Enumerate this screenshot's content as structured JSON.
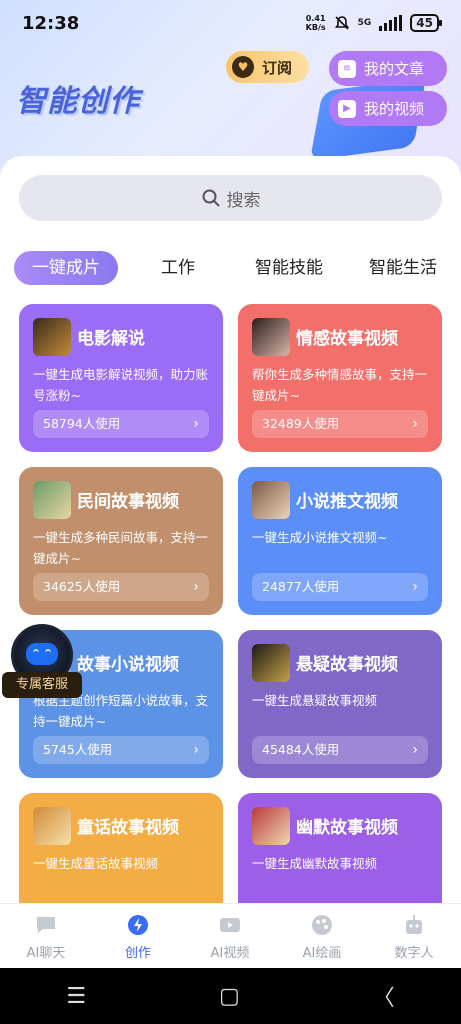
{
  "status_bar": {
    "time": "12:38",
    "net_speed_value": "0.41",
    "net_speed_unit": "KB/s",
    "network": "5G",
    "battery": "45"
  },
  "header": {
    "brand_title": "智能创作",
    "subscribe_label": "订阅",
    "my_articles_label": "我的文章",
    "my_videos_label": "我的视频"
  },
  "search": {
    "label": "搜索"
  },
  "tabs": [
    {
      "label": "一键成片",
      "active": true
    },
    {
      "label": "工作",
      "active": false
    },
    {
      "label": "智能技能",
      "active": false
    },
    {
      "label": "智能生活",
      "active": false
    }
  ],
  "cards": [
    {
      "title": "电影解说",
      "desc": "一键生成电影解说视频，助力账号涨粉~",
      "usage": "58794人使用",
      "color": "#9b6cf5"
    },
    {
      "title": "情感故事视频",
      "desc": "帮你生成多种情感故事，支持一键成片~",
      "usage": "32489人使用",
      "color": "#f36f6a"
    },
    {
      "title": "民间故事视频",
      "desc": "一键生成多种民间故事，支持一键成片~",
      "usage": "34625人使用",
      "color": "#c18f6b"
    },
    {
      "title": "小说推文视频",
      "desc": "一键生成小说推文视频~",
      "usage": "24877人使用",
      "color": "#5b8ef7"
    },
    {
      "title": "故事小说视频",
      "desc": "根据主题创作短篇小说故事，支持一键成片~",
      "usage": "5745人使用",
      "color": "#5d93e6"
    },
    {
      "title": "悬疑故事视频",
      "desc": "一键生成悬疑故事视频",
      "usage": "45484人使用",
      "color": "#8068c9"
    },
    {
      "title": "童话故事视频",
      "desc": "一键生成童话故事视频",
      "usage": "",
      "color": "#f4ad45"
    },
    {
      "title": "幽默故事视频",
      "desc": "一键生成幽默故事视频",
      "usage": "",
      "color": "#9b5fe8"
    }
  ],
  "customer_service": {
    "label": "专属客服"
  },
  "bottom_nav": [
    {
      "label": "AI聊天",
      "active": false
    },
    {
      "label": "创作",
      "active": true
    },
    {
      "label": "AI视频",
      "active": false
    },
    {
      "label": "AI绘画",
      "active": false
    },
    {
      "label": "数字人",
      "active": false
    }
  ],
  "system_nav": {
    "recent_glyph": "☰",
    "home_glyph": "▢",
    "back_glyph": "〈"
  }
}
